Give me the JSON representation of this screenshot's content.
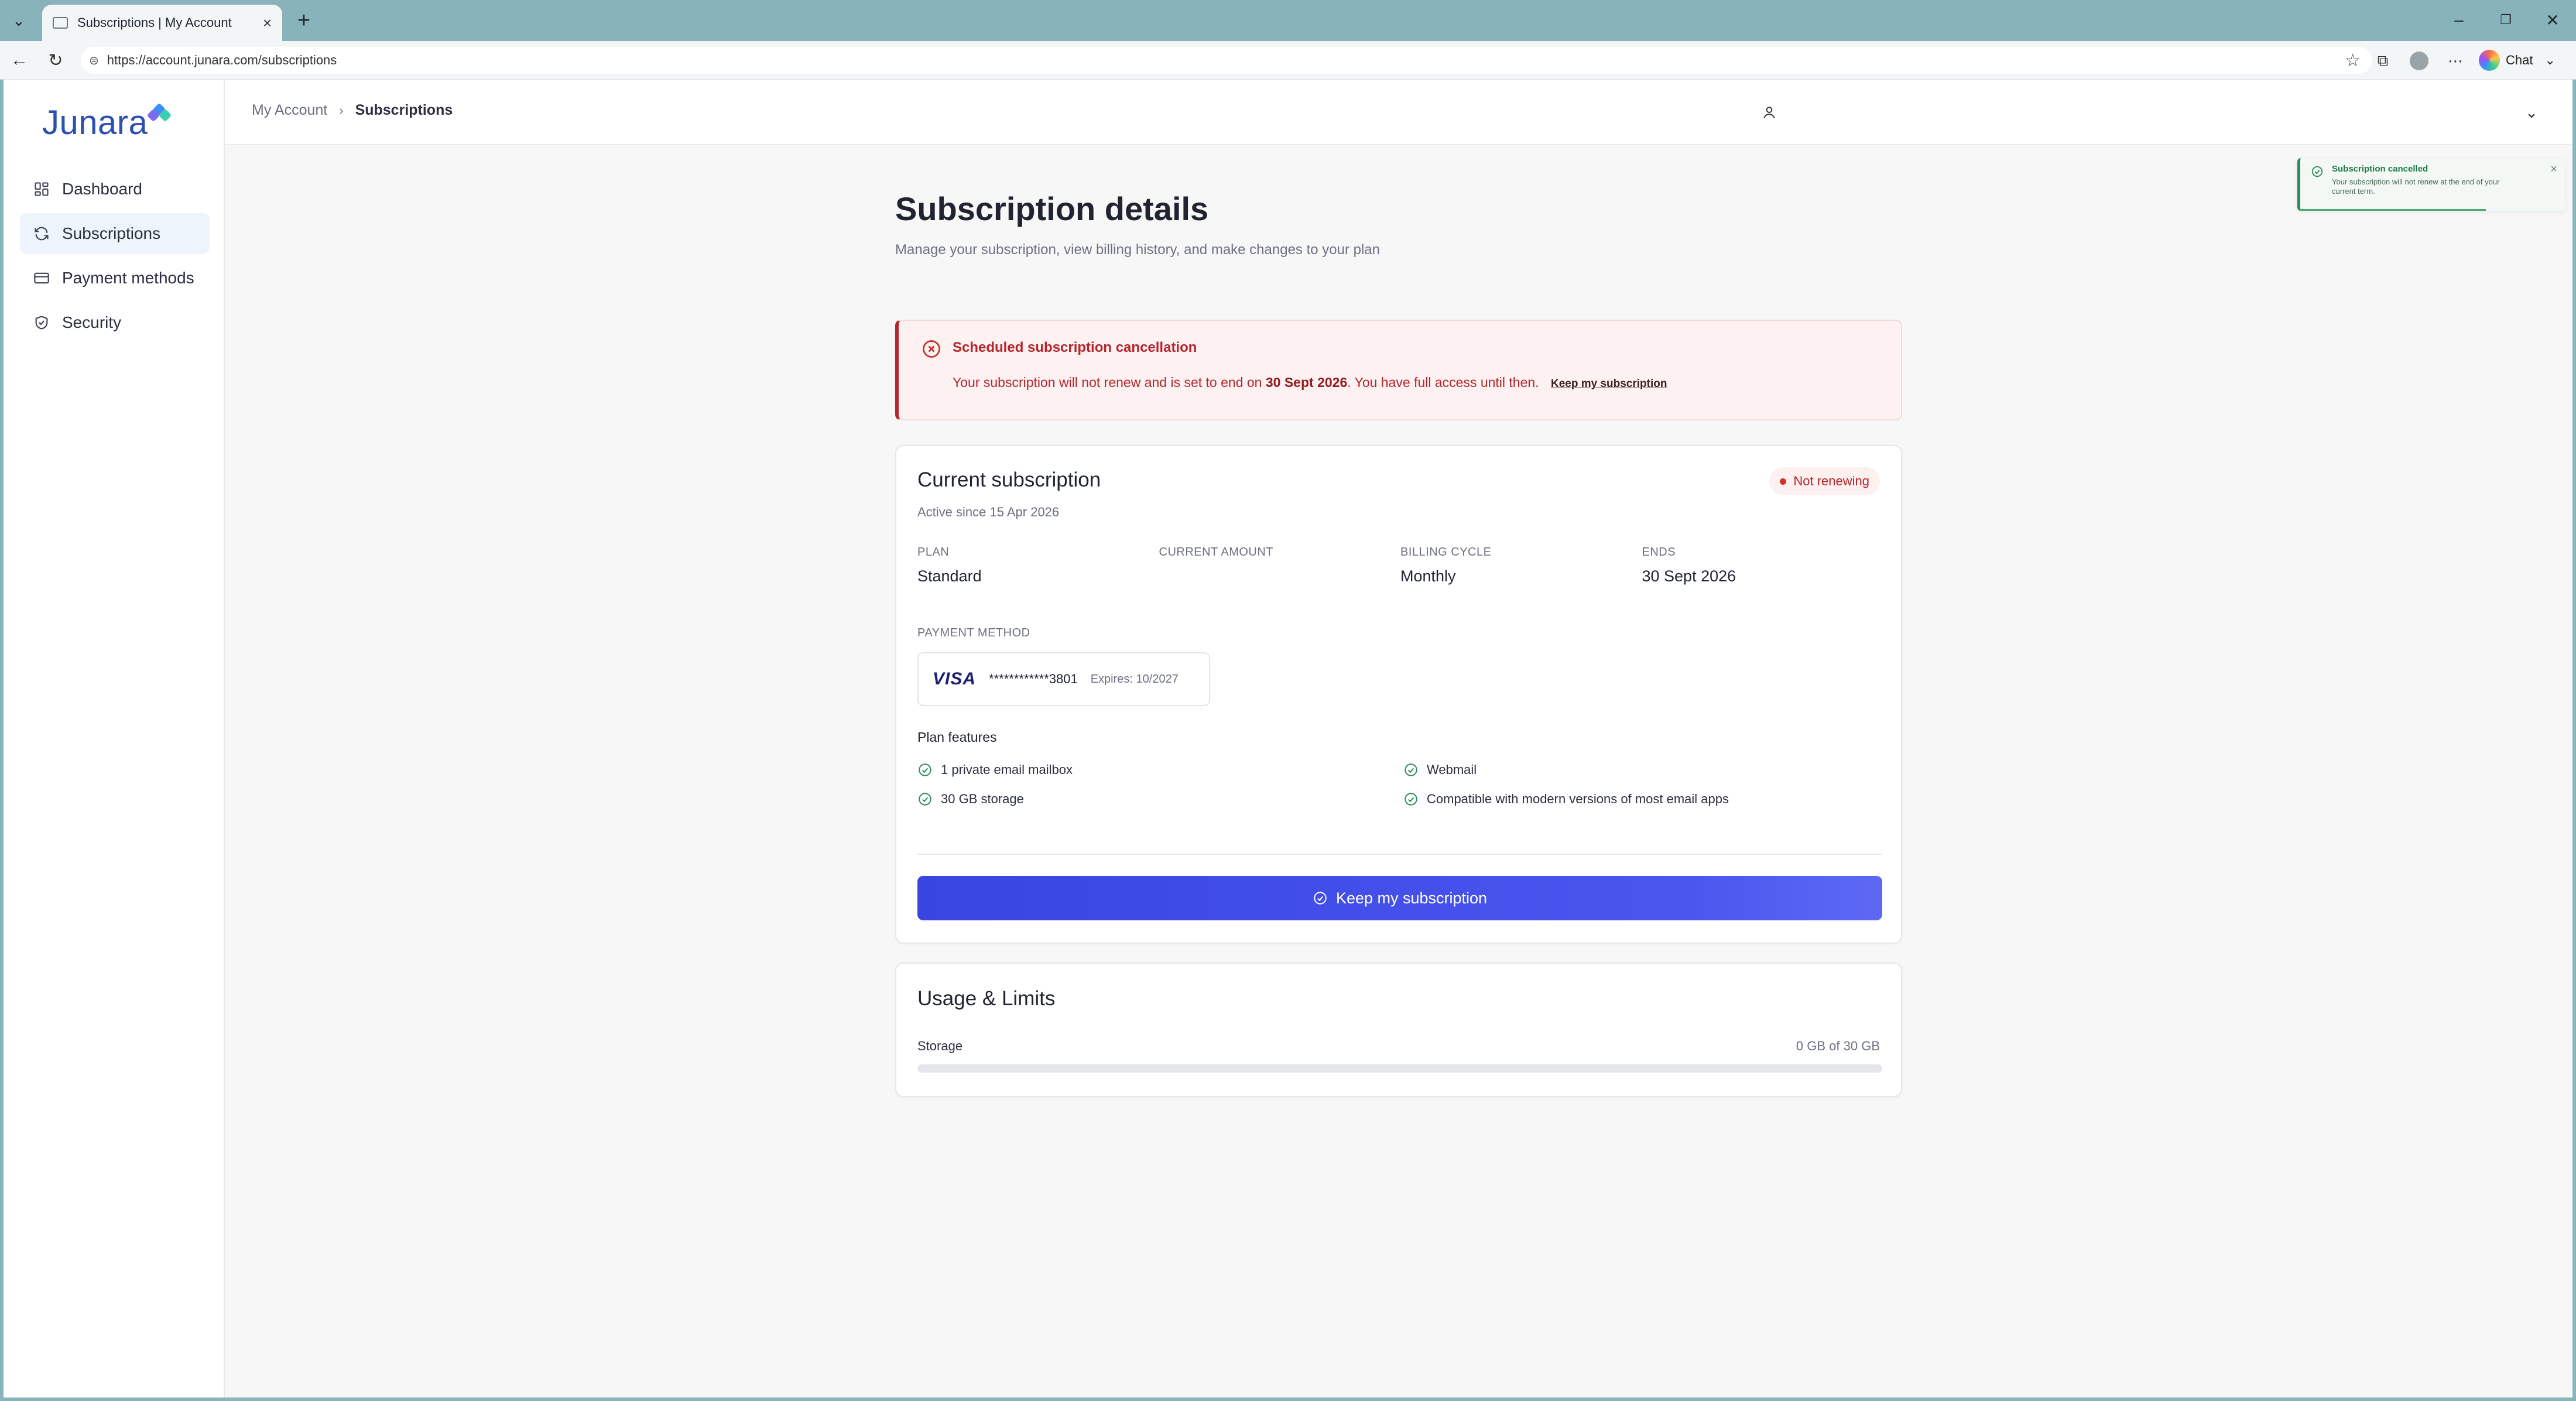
{
  "browser": {
    "tab_title": "Subscriptions | My Account",
    "url": "https://account.junara.com/subscriptions",
    "chat_label": "Chat"
  },
  "app": {
    "logo_text": "Junara",
    "nav": [
      {
        "label": "Dashboard",
        "icon": "dashboard-icon",
        "active": false
      },
      {
        "label": "Subscriptions",
        "icon": "refresh-icon",
        "active": true
      },
      {
        "label": "Payment methods",
        "icon": "credit-card-icon",
        "active": false
      },
      {
        "label": "Security",
        "icon": "shield-check-icon",
        "active": false
      }
    ],
    "breadcrumb": {
      "parent": "My Account",
      "current": "Subscriptions"
    }
  },
  "toast": {
    "title": "Subscription cancelled",
    "message": "Your subscription will not renew at the end of your current term."
  },
  "page": {
    "title": "Subscription details",
    "subtitle": "Manage your subscription, view billing history, and make changes to your plan"
  },
  "alert": {
    "title": "Scheduled subscription cancellation",
    "body_prefix": "Your subscription will not renew and is set to end on",
    "end_date": "30 Sept 2026",
    "body_suffix": ". You have full access until then.",
    "link": "Keep my subscription"
  },
  "subscription": {
    "title": "Current subscription",
    "active_since": "Active since 15 Apr 2026",
    "status": "Not renewing",
    "fields": [
      {
        "label": "PLAN",
        "value": "Standard"
      },
      {
        "label": "CURRENT AMOUNT",
        "value": ""
      },
      {
        "label": "BILLING CYCLE",
        "value": "Monthly"
      },
      {
        "label": "ENDS",
        "value": "30 Sept 2026"
      }
    ],
    "payment_method_label": "PAYMENT METHOD",
    "card_brand": "VISA",
    "card_number": "************3801",
    "card_expiry": "Expires: 10/2027",
    "features_title": "Plan features",
    "features": [
      "1 private email mailbox",
      "Webmail",
      "30 GB storage",
      "Compatible with modern versions of most email apps"
    ],
    "keep_button": "Keep my subscription"
  },
  "usage": {
    "title": "Usage & Limits",
    "storage_label": "Storage",
    "storage_value": "0 GB of 30 GB",
    "storage_fraction": 0
  },
  "colors": {
    "accent": "#3945e0",
    "danger": "#b3262b",
    "success": "#2e8b57",
    "brand": "#2d4fb0"
  }
}
